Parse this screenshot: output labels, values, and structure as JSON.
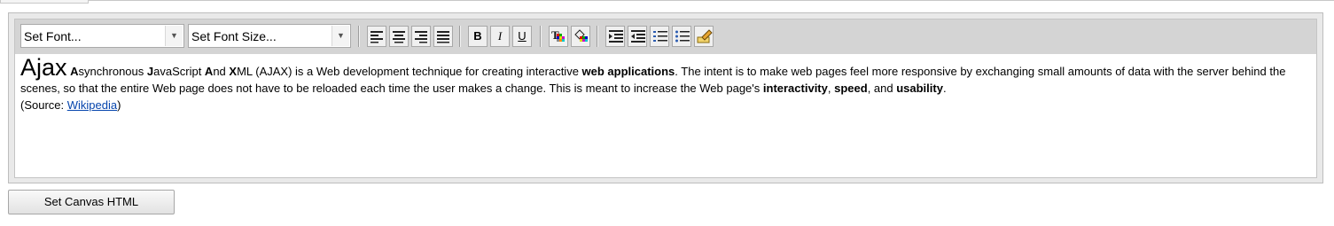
{
  "toolbar": {
    "font_select": {
      "value": "Set Font..."
    },
    "size_select": {
      "value": "Set Font Size..."
    },
    "buttons": {
      "bold": "B",
      "italic": "I",
      "underline": "U"
    },
    "icons": [
      "align-left-icon",
      "align-center-icon",
      "align-right-icon",
      "align-justify-icon",
      "bold-icon",
      "italic-icon",
      "underline-icon",
      "text-color-icon",
      "background-color-icon",
      "indent-icon",
      "outdent-icon",
      "ordered-list-icon",
      "unordered-list-icon",
      "insert-link-icon"
    ]
  },
  "content": {
    "title": "Ajax",
    "p1": [
      {
        "t": "A",
        "b": true
      },
      {
        "t": "synchronous "
      },
      {
        "t": "J",
        "b": true
      },
      {
        "t": "avaScript "
      },
      {
        "t": "A",
        "b": true
      },
      {
        "t": "nd "
      },
      {
        "t": "X",
        "b": true
      },
      {
        "t": "ML (AJAX) is a Web development technique for creating interactive "
      },
      {
        "t": "web applications",
        "b": true
      },
      {
        "t": ". The intent is to make web pages feel more responsive by exchanging small amounts of data with the server behind the scenes, so that the entire Web page does not have to be reloaded each time the user makes a change. This is meant to increase the Web page's "
      },
      {
        "t": "interactivity",
        "b": true
      },
      {
        "t": ", "
      },
      {
        "t": "speed",
        "b": true
      },
      {
        "t": ", and "
      },
      {
        "t": "usability",
        "b": true
      },
      {
        "t": "."
      }
    ],
    "source_prefix": "(Source: ",
    "source_link": "Wikipedia",
    "source_suffix": ")"
  },
  "actions": {
    "set_canvas_label": "Set Canvas HTML"
  },
  "colors": {
    "toolbar_bg": "#d4d4d4",
    "frame_bg": "#e9e9e9",
    "link": "#0645ad"
  }
}
